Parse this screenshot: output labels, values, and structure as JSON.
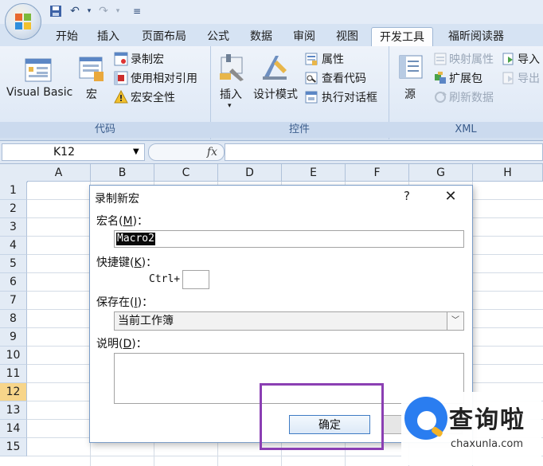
{
  "quick_access": {
    "save_icon": "save-icon",
    "undo_icon": "undo-icon",
    "redo_icon": "redo-icon",
    "customize_icon": "customize-qat-icon"
  },
  "tabs": [
    {
      "label": "开始"
    },
    {
      "label": "插入"
    },
    {
      "label": "页面布局"
    },
    {
      "label": "公式"
    },
    {
      "label": "数据"
    },
    {
      "label": "审阅"
    },
    {
      "label": "视图"
    },
    {
      "label": "开发工具",
      "active": true
    },
    {
      "label": "福昕阅读器"
    }
  ],
  "ribbon": {
    "code_group": {
      "label": "代码",
      "visual_basic": "Visual Basic",
      "macros": "宏",
      "record_macro": "录制宏",
      "relative_refs": "使用相对引用",
      "macro_security": "宏安全性"
    },
    "controls_group": {
      "label": "控件",
      "insert": "插入",
      "design_mode": "设计模式",
      "properties": "属性",
      "view_code": "查看代码",
      "run_dialog": "执行对话框"
    },
    "xml_group": {
      "label": "XML",
      "source": "源",
      "map_properties": "映射属性",
      "expansion_packs": "扩展包",
      "refresh_data": "刷新数据",
      "import": "导入",
      "export": "导出"
    }
  },
  "formula_bar": {
    "name_box": "K12",
    "fx": "fx",
    "formula": ""
  },
  "sheet": {
    "columns": [
      "A",
      "B",
      "C",
      "D",
      "E",
      "F",
      "G",
      "H"
    ],
    "rows": [
      "1",
      "2",
      "3",
      "4",
      "5",
      "6",
      "7",
      "8",
      "9",
      "10",
      "11",
      "12",
      "13",
      "14",
      "15"
    ],
    "active_row": "12"
  },
  "dialog": {
    "title": "录制新宏",
    "help": "?",
    "close": "✕",
    "macro_name_label": "宏名(",
    "macro_name_key": "M",
    "macro_name_tail": ")：",
    "macro_name_value": "Macro2",
    "shortcut_label": "快捷键(",
    "shortcut_key": "K",
    "shortcut_tail": ")：",
    "ctrl_prefix": "Ctrl+",
    "shortcut_value": "",
    "store_label": "保存在(",
    "store_key": "I",
    "store_tail": ")：",
    "store_value": "当前工作簿",
    "desc_label": "说明(",
    "desc_key": "D",
    "desc_tail": ")：",
    "desc_value": "",
    "ok": "确定",
    "cancel": ""
  },
  "watermark": {
    "text": "查询啦",
    "url": "chaxunla.com"
  },
  "colors": {
    "highlight": "#8b3fb3",
    "accent": "#2a7df0"
  }
}
